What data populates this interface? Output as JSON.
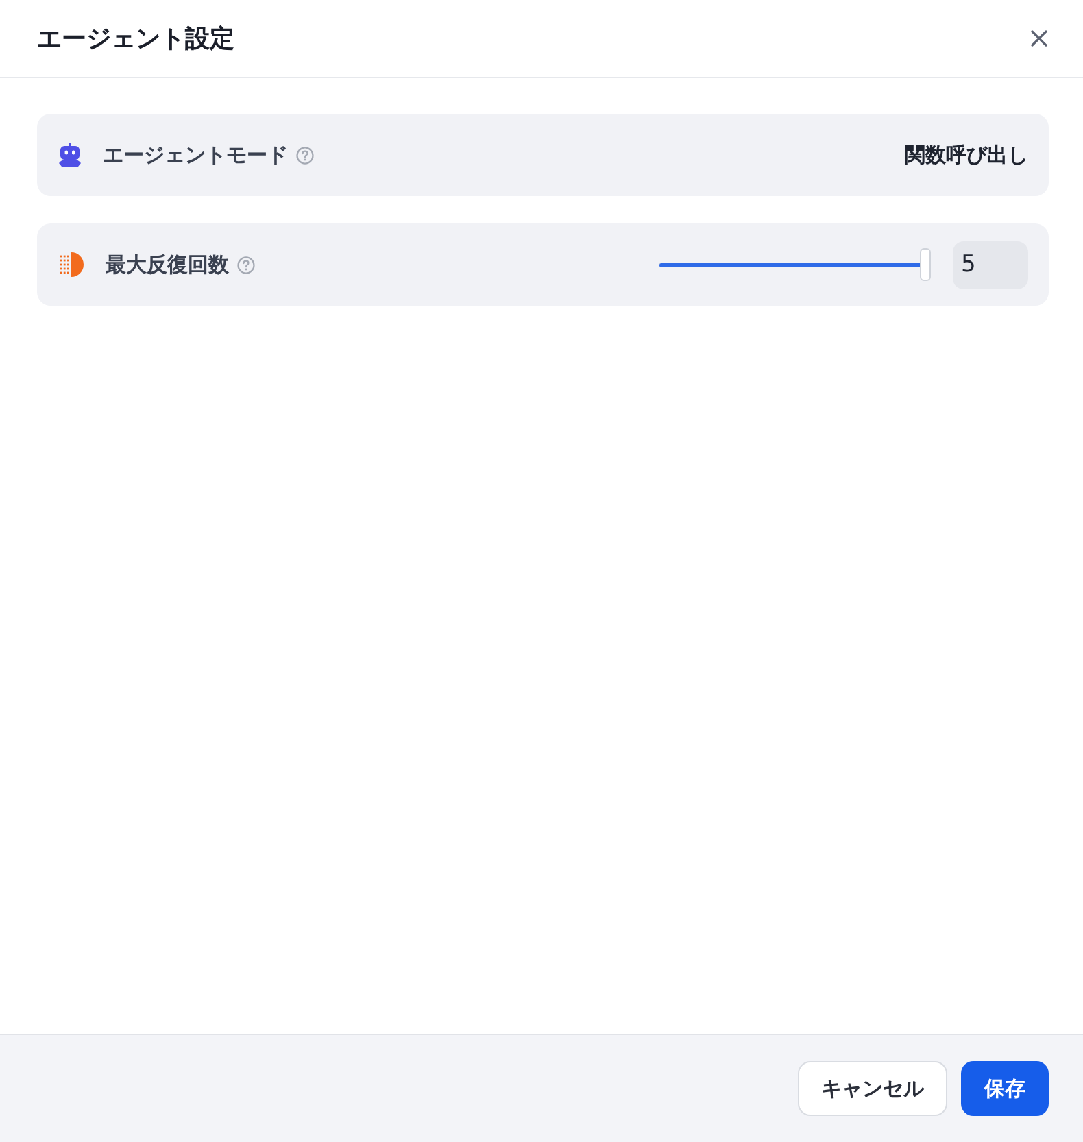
{
  "dialog": {
    "title": "エージェント設定"
  },
  "settings": [
    {
      "kind": "value",
      "label": "エージェントモード",
      "value": "関数呼び出し"
    },
    {
      "kind": "slider",
      "label": "最大反復回数",
      "level": 1,
      "value": "5"
    }
  ],
  "footer": {
    "buttons": [
      {
        "kind": "secondary",
        "label": "キャンセル"
      },
      {
        "kind": "primary",
        "label": "保存"
      }
    ]
  }
}
